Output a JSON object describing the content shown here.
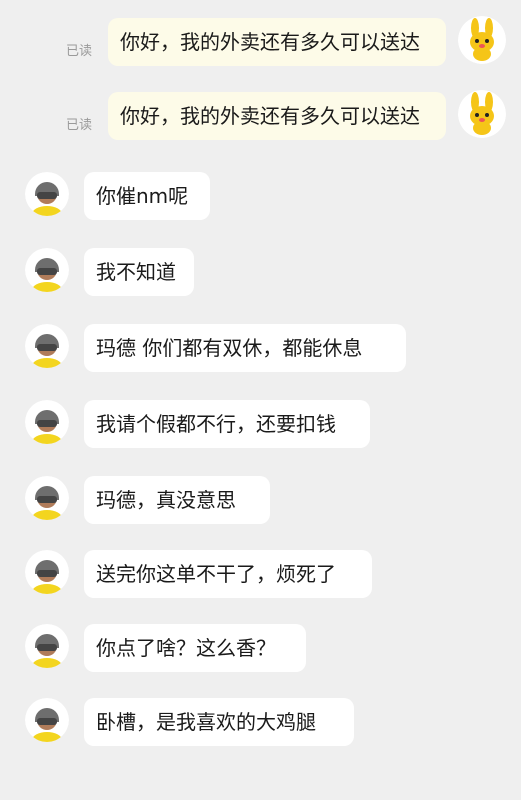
{
  "sent": [
    {
      "read_status": "已读",
      "text": "你好，我的外卖还有多久可以送达",
      "avatar": "yellow-rabbit-avatar"
    },
    {
      "read_status": "已读",
      "text": "你好，我的外卖还有多久可以送达",
      "avatar": "yellow-rabbit-avatar"
    }
  ],
  "received": [
    {
      "text": "你催nm呢",
      "avatar": "courier-helmet-avatar"
    },
    {
      "text": "我不知道",
      "avatar": "courier-helmet-avatar"
    },
    {
      "text": "玛德 你们都有双休，都能休息",
      "avatar": "courier-helmet-avatar"
    },
    {
      "text": "我请个假都不行，还要扣钱",
      "avatar": "courier-helmet-avatar"
    },
    {
      "text": "玛德，真没意思",
      "avatar": "courier-helmet-avatar"
    },
    {
      "text": "送完你这单不干了，烦死了",
      "avatar": "courier-helmet-avatar"
    },
    {
      "text": "你点了啥？这么香？",
      "avatar": "courier-helmet-avatar"
    },
    {
      "text": "卧槽，是我喜欢的大鸡腿",
      "avatar": "courier-helmet-avatar"
    }
  ],
  "colors": {
    "background": "#efefef",
    "sent_bubble": "#fdfbe8",
    "received_bubble": "#ffffff",
    "courier_shirt": "#f3d51f",
    "rabbit": "#f5c518"
  }
}
